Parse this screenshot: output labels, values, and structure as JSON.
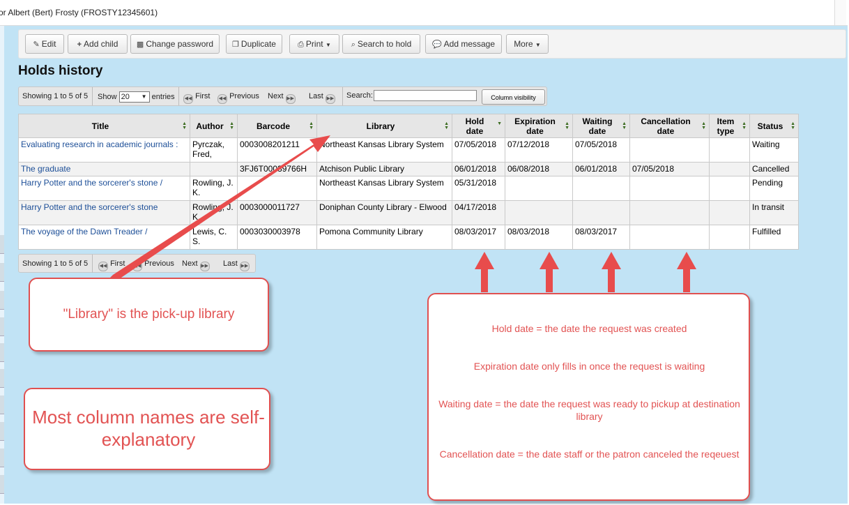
{
  "window": {
    "title": "or Albert (Bert) Frosty (FROSTY12345601)"
  },
  "toolbar": {
    "edit": "Edit",
    "add_child": "Add child",
    "change_password": "Change password",
    "duplicate": "Duplicate",
    "print": "Print",
    "search_to_hold": "Search to hold",
    "add_message": "Add message",
    "more": "More"
  },
  "page": {
    "heading": "Holds history"
  },
  "pager_top": {
    "info": "Showing 1 to 5 of 5",
    "show_label": "Show",
    "show_value": "20",
    "entries_label": "entries",
    "first": "First",
    "previous": "Previous",
    "next": "Next",
    "last": "Last",
    "search_label": "Search:",
    "column_visibility": "Column visibility"
  },
  "pager_bottom": {
    "info": "Showing 1 to 5 of 5",
    "first": "First",
    "previous": "Previous",
    "next": "Next",
    "last": "Last"
  },
  "table": {
    "headers": {
      "title": "Title",
      "author": "Author",
      "barcode": "Barcode",
      "library": "Library",
      "hold_date_1": "Hold",
      "hold_date_2": "date",
      "expiration_date_1": "Expiration",
      "expiration_date_2": "date",
      "waiting_date_1": "Waiting",
      "waiting_date_2": "date",
      "cancellation_date_1": "Cancellation",
      "cancellation_date_2": "date",
      "item_type_1": "Item",
      "item_type_2": "type",
      "status": "Status"
    },
    "rows": [
      {
        "title": "Evaluating research in academic journals :",
        "author": "Pyrczak, Fred,",
        "barcode": "0003008201211",
        "library": "Northeast Kansas Library System",
        "hold_date": "07/05/2018",
        "expiration_date": "07/12/2018",
        "waiting_date": "07/05/2018",
        "cancellation_date": "",
        "item_type": "",
        "status": "Waiting"
      },
      {
        "title": "The graduate",
        "author": "",
        "barcode": "3FJ6T00039766H",
        "library": "Atchison Public Library",
        "hold_date": "06/01/2018",
        "expiration_date": "06/08/2018",
        "waiting_date": "06/01/2018",
        "cancellation_date": "07/05/2018",
        "item_type": "",
        "status": "Cancelled"
      },
      {
        "title": "Harry Potter and the sorcerer's stone /",
        "author": "Rowling, J. K.",
        "barcode": "",
        "library": "Northeast Kansas Library System",
        "hold_date": "05/31/2018",
        "expiration_date": "",
        "waiting_date": "",
        "cancellation_date": "",
        "item_type": "",
        "status": "Pending"
      },
      {
        "title": "Harry Potter and the sorcerer's stone",
        "author": "Rowling, J. K.",
        "barcode": "0003000011727",
        "library": "Doniphan County Library - Elwood",
        "hold_date": "04/17/2018",
        "expiration_date": "",
        "waiting_date": "",
        "cancellation_date": "",
        "item_type": "",
        "status": "In transit"
      },
      {
        "title": "The voyage of the Dawn Treader /",
        "author": "Lewis, C. S.",
        "barcode": "0003030003978",
        "library": "Pomona Community Library",
        "hold_date": "08/03/2017",
        "expiration_date": "08/03/2018",
        "waiting_date": "08/03/2017",
        "cancellation_date": "",
        "item_type": "",
        "status": "Fulfilled"
      }
    ]
  },
  "annotations": {
    "library_note": "\"Library\" is the pick-up library",
    "columns_note": "Most column names are self-explanatory",
    "hold_date_note": "Hold date = the date the request was created",
    "expiration_note": "Expiration date only fills in once the request is waiting",
    "waiting_note": "Waiting date = the date the request was ready to pickup at destination library",
    "cancellation_note": "Cancellation date = the date staff or the patron canceled the reqeuest"
  },
  "colors": {
    "background_blue": "#c1e3f5",
    "link": "#1c4e97",
    "annotation_red": "#e25353"
  }
}
